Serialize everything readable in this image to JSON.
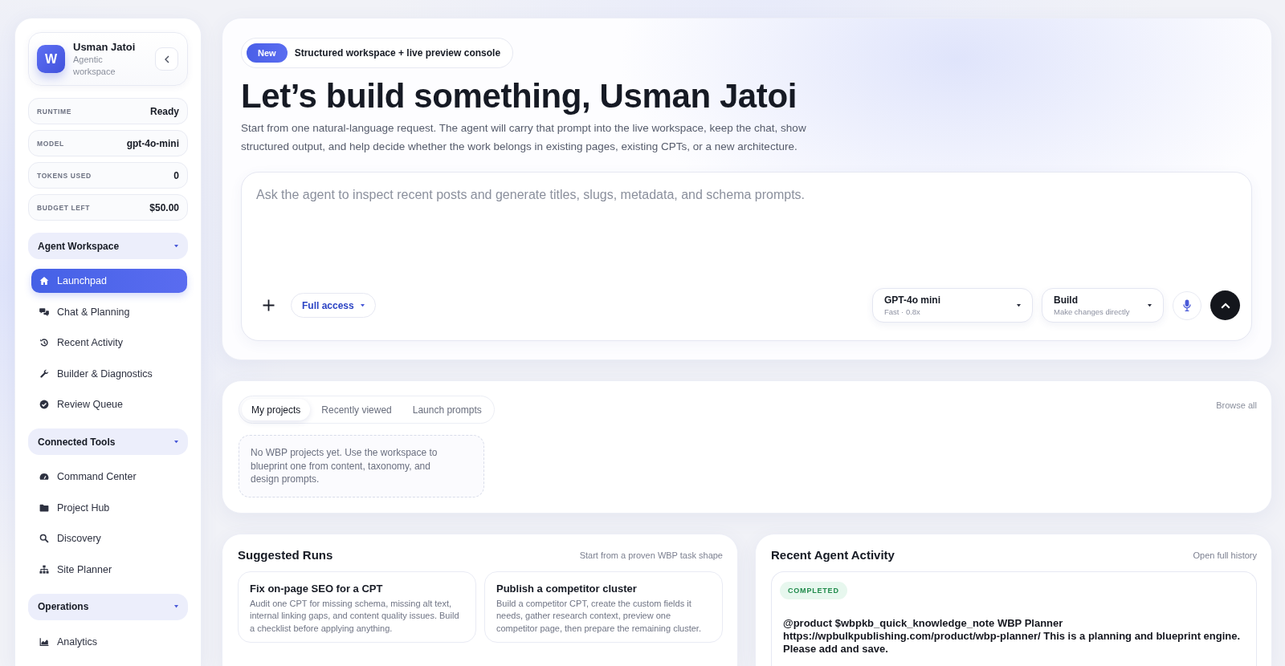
{
  "sidebar": {
    "profile": {
      "initial": "W",
      "name": "Usman Jatoi",
      "subtitle": "Agentic workspace"
    },
    "stats": [
      {
        "label": "RUNTIME",
        "value": "Ready"
      },
      {
        "label": "MODEL",
        "value": "gpt-4o-mini"
      },
      {
        "label": "TOKENS USED",
        "value": "0"
      },
      {
        "label": "BUDGET LEFT",
        "value": "$50.00"
      }
    ],
    "sections": [
      {
        "title": "Agent Workspace",
        "expanded": true,
        "items": [
          {
            "label": "Launchpad",
            "selected": true
          },
          {
            "label": "Chat & Planning",
            "selected": false
          },
          {
            "label": "Recent Activity",
            "selected": false
          },
          {
            "label": "Builder & Diagnostics",
            "selected": false
          },
          {
            "label": "Review Queue",
            "selected": false
          }
        ]
      },
      {
        "title": "Connected Tools",
        "expanded": true,
        "items": [
          {
            "label": "Command Center",
            "selected": false
          },
          {
            "label": "Project Hub",
            "selected": false
          },
          {
            "label": "Discovery",
            "selected": false
          },
          {
            "label": "Site Planner",
            "selected": false
          }
        ]
      },
      {
        "title": "Operations",
        "expanded": true,
        "items": [
          {
            "label": "Analytics",
            "selected": false
          }
        ]
      }
    ]
  },
  "hero": {
    "badge": "New",
    "tagline": "Structured workspace + live preview console",
    "title": "Let’s build something, Usman Jatoi",
    "description": "Start from one natural-language request. The agent will carry that prompt into the live workspace, keep the chat, show structured output, and help decide whether the work belongs in existing pages, existing CPTs, or a new architecture."
  },
  "composer": {
    "placeholder": "Ask the agent to inspect recent posts and generate titles, slugs, metadata, and schema prompts.",
    "access": "Full access",
    "model": {
      "name": "GPT-4o mini",
      "detail": "Fast · 0.8x"
    },
    "mode": {
      "name": "Build",
      "detail": "Make changes directly"
    }
  },
  "projects": {
    "tabs": [
      {
        "label": "My projects",
        "selected": true
      },
      {
        "label": "Recently viewed",
        "selected": false
      },
      {
        "label": "Launch prompts",
        "selected": false
      }
    ],
    "browse_link": "Browse all",
    "empty_message": "No WBP projects yet. Use the workspace to blueprint one from content, taxonomy, and design prompts."
  },
  "suggested_runs": {
    "title": "Suggested Runs",
    "subtitle": "Start from a proven WBP task shape",
    "runs": [
      {
        "title": "Fix on-page SEO for a CPT",
        "description": "Audit one CPT for missing schema, missing alt text, internal linking gaps, and content quality issues. Build a checklist before applying anything."
      },
      {
        "title": "Publish a competitor cluster",
        "description": "Build a competitor CPT, create the custom fields it needs, gather research context, preview one competitor page, then prepare the remaining cluster."
      }
    ]
  },
  "recent_activity": {
    "title": "Recent Agent Activity",
    "link": "Open full history",
    "entries": [
      {
        "status": "COMPLETED",
        "text": "@product $wbpkb_quick_knowledge_note WBP Planner https://wpbulkpublishing.com/product/wbp-planner/ This is a planning and blueprint engine. Please add and save."
      }
    ]
  }
}
